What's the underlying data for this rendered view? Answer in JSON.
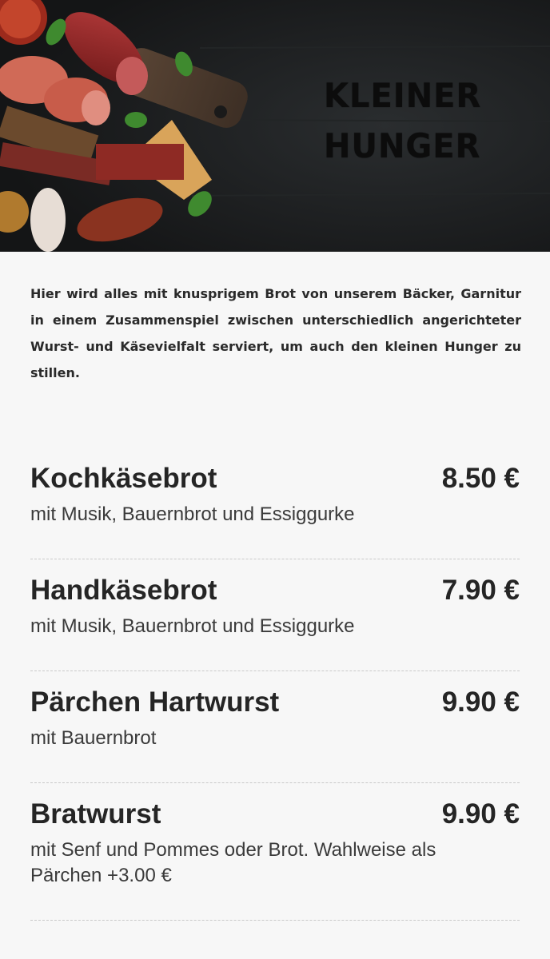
{
  "hero": {
    "title_line1": "KLEINER",
    "title_line2": "HUNGER",
    "image": "charcuterie-board-image"
  },
  "intro_text": "Hier wird alles mit knusprigem Brot von unserem Bäcker, Garnitur in einem Zusammenspiel zwischen unterschiedlich angerichteter Wurst- und Käsevielfalt serviert, um auch den kleinen Hunger zu stillen.",
  "menu": {
    "items": [
      {
        "name": "Kochkäsebrot",
        "price": "8.50 €",
        "description": "mit Musik, Bauernbrot und Essiggurke"
      },
      {
        "name": "Handkäsebrot",
        "price": "7.90 €",
        "description": "mit Musik, Bauernbrot und Essiggurke"
      },
      {
        "name": "Pärchen Hartwurst",
        "price": "9.90 €",
        "description": "mit Bauernbrot"
      },
      {
        "name": "Bratwurst",
        "price": "9.90 €",
        "description": "mit Senf und Pommes oder Brot. Wahlweise als Pärchen +3.00 €"
      }
    ]
  },
  "colors": {
    "background": "#f7f7f7",
    "hero_background": "#1b1d1e",
    "text": "#252525",
    "divider": "#c9c9c9"
  }
}
